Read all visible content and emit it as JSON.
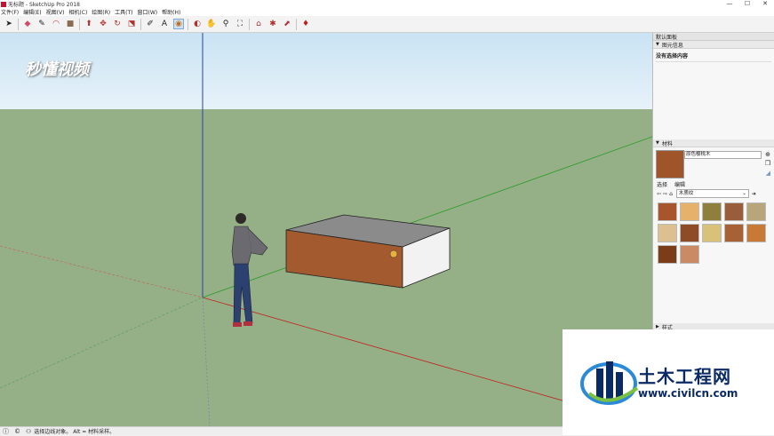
{
  "window": {
    "title": "无标题 - SketchUp Pro 2018",
    "minimize": "—",
    "maximize": "☐",
    "close": "✕"
  },
  "menu": [
    "文件(F)",
    "编辑(E)",
    "视图(V)",
    "相机(C)",
    "绘图(R)",
    "工具(T)",
    "窗口(W)",
    "帮助(H)"
  ],
  "toolbar_icons": [
    "select-icon",
    "eraser-icon",
    "line-icon",
    "arc-icon",
    "rectangle-icon",
    "push-pull-icon",
    "move-icon",
    "rotate-icon",
    "scale-icon",
    "tape-measure-icon",
    "text-icon",
    "paint-bucket-icon",
    "orbit-icon",
    "pan-icon",
    "zoom-icon",
    "zoom-extents-icon",
    "warehouse-icon",
    "extension-icon",
    "share-icon",
    "ruby-icon"
  ],
  "watermark": "秒懂视频",
  "tray": {
    "title": "默认面板",
    "entity_info": {
      "header": "图元信息",
      "text": "没有选择内容"
    },
    "materials": {
      "header": "材料",
      "current_name": "原色樱桃木",
      "tab_select": "选择",
      "tab_edit": "编辑",
      "library": "木质纹",
      "swatches": [
        "#a8552e",
        "#e6b26b",
        "#8f7f3c",
        "#9a5d3b",
        "#b8a57a",
        "#ddc08f",
        "#8e4b25",
        "#d8c27a",
        "#a86035",
        "#c77a36",
        "#7a3d18",
        "#c98a64"
      ]
    },
    "bottom_header": "样式"
  },
  "status": {
    "text": "选择边线对象。 Alt = 材料采样。"
  },
  "logo": {
    "name": "土木工程网",
    "url": "www.civilcn.com"
  },
  "colors": {
    "sky_top": "#c9e3f3",
    "ground": "#95b086",
    "box_front": "#a35a2f",
    "box_top": "#8a8a8a",
    "box_side": "#f2f2f2"
  }
}
